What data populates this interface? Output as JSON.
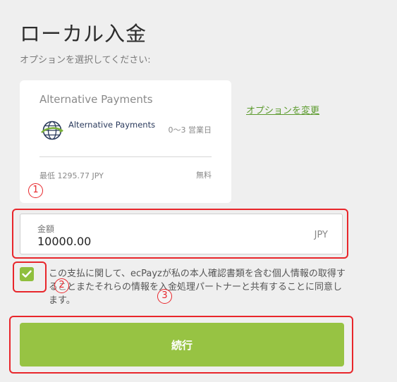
{
  "page": {
    "title": "ローカル入金",
    "subtitle": "オプションを選択してください:"
  },
  "payment_card": {
    "title": "Alternative Payments",
    "method_name": "Alternative Payments",
    "method_icon": "globe-icon",
    "eta": "0〜3 営業日",
    "min_amount": "最低 1295.77 JPY",
    "fee": "無料"
  },
  "change_option_link": "オプションを変更",
  "amount_field": {
    "label": "金額",
    "value": "10000.00",
    "currency": "JPY"
  },
  "consent": {
    "checked": true,
    "text": "この支払に関して、ecPayzが私の本人確認書類を含む個人情報の取得することまたそれらの情報を入金処理パートナーと共有することに同意します。"
  },
  "continue_button": "続行",
  "annotations": {
    "marker_1": "1",
    "marker_2": "2",
    "marker_3": "3",
    "highlight_color": "#e8262b"
  },
  "colors": {
    "accent_green": "#97c343",
    "link_green": "#5d9b2f",
    "background": "#efefef"
  }
}
